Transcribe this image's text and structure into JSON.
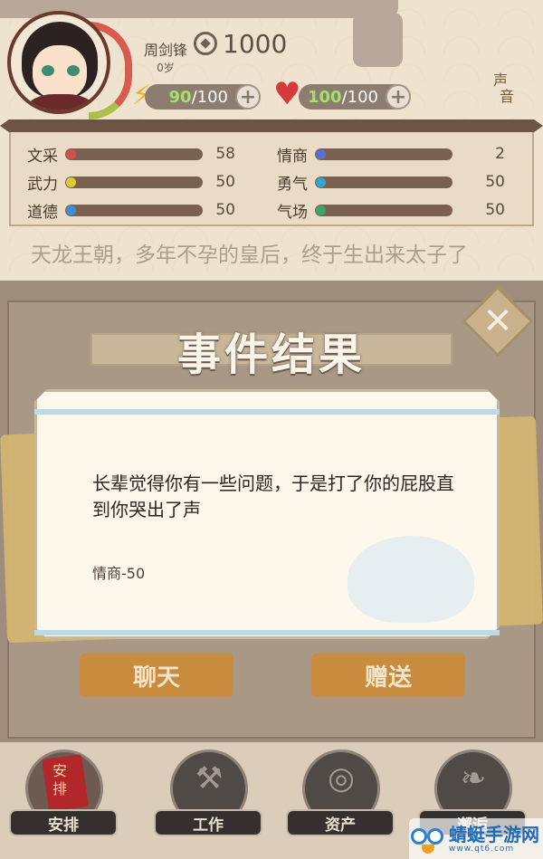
{
  "header": {
    "name": "周剑锋",
    "age": "0岁",
    "coins": "1000",
    "energy_current": "90",
    "energy_max": "/100",
    "health_current": "100",
    "health_max": "/100",
    "sound_label_1": "声",
    "sound_label_2": "音"
  },
  "stats": [
    {
      "label": "文采",
      "value": "58",
      "color": "#d94c4c"
    },
    {
      "label": "情商",
      "value": "2",
      "color": "#5a6fd0"
    },
    {
      "label": "武力",
      "value": "50",
      "color": "#d8cf2f"
    },
    {
      "label": "勇气",
      "value": "50",
      "color": "#2fa7d0"
    },
    {
      "label": "道德",
      "value": "50",
      "color": "#3b8fd9"
    },
    {
      "label": "气场",
      "value": "50",
      "color": "#37a86a"
    }
  ],
  "story_text": "天龙王朝，多年不孕的皇后，终于生出来太子了",
  "dialog": {
    "title": "事件结果",
    "text": "长辈觉得你有一些问题，于是打了你的屁股直到你哭出了声",
    "effect": "情商-50",
    "close": "✕"
  },
  "actions": {
    "chat": "聊天",
    "gift": "赠送"
  },
  "nav": {
    "arrange": "安排",
    "arrange_icon_text": "安排",
    "work": "工作",
    "assets": "资产",
    "recent": "邂逅"
  },
  "watermark": {
    "text": "蜻蜓手游网",
    "sub": "www.qt6.com"
  }
}
